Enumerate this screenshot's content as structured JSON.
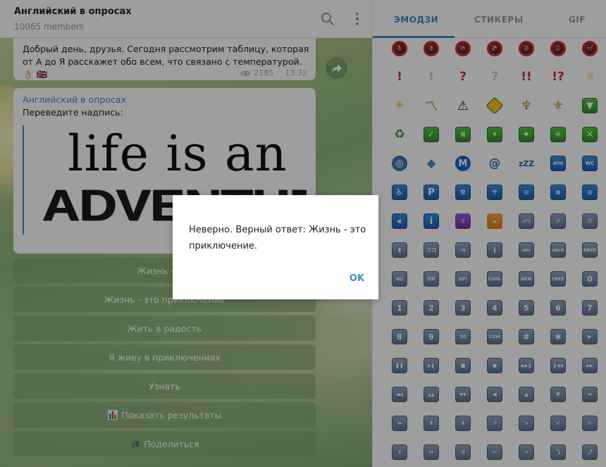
{
  "chat": {
    "title": "Английский в опросах",
    "members": "10065 members",
    "message1": {
      "text": "Добрый день, друзья. Сегодня рассмотрим таблицу, которая от А до Я расскажет обо всем, что связано с температурой. 👌🏻 🇬🇧",
      "views": "2185",
      "time": "13:32"
    },
    "message2": {
      "sender": "Английский в опросах",
      "caption": "Переведите надпись:",
      "image_line1": "life is an",
      "image_line2": "ADVENTURE"
    },
    "poll_options": [
      "Жизнь - это",
      "Жизнь - это приключение",
      "Жить в радость",
      "Я живу в приключениях",
      "Узнать",
      "Показать результаты",
      "Поделиться"
    ]
  },
  "emoji_panel": {
    "tabs": [
      "ЭМОДЗИ",
      "СТИКЕРЫ",
      "GIF"
    ],
    "active_tab": "ЭМОДЗИ",
    "accent_color": "#3a8fc6"
  },
  "dialog": {
    "message": "Неверно. Верный ответ: Жизнь - это приключение.",
    "ok_label": "OK"
  }
}
